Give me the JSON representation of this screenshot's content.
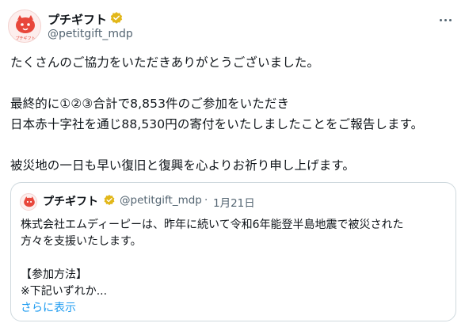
{
  "author": {
    "name": "プチギフト",
    "handle": "@petitgift_mdp",
    "logo_text": "プチギフト",
    "verified_color": "#e2b719"
  },
  "post": {
    "lines": [
      "たくさんのご協力をいただきありがとうございました。",
      "最終的に①②③合計で8,853件のご参加をいただき",
      "日本赤十字社を通じ88,530円の寄付をいたしましたことをご報告します。",
      "被災地の一日も早い復旧と復興を心よりお祈り申し上げます。"
    ]
  },
  "quote": {
    "author_name": "プチギフト",
    "author_handle": "@petitgift_mdp",
    "separator": "·",
    "date": "1月21日",
    "lines": [
      "株式会社エムディーピーは、昨年に続いて令和6年能登半島地震で被災された",
      "方々を支援いたします。",
      "【参加方法】",
      "※下記いずれか..."
    ],
    "show_more": "さらに表示"
  },
  "colors": {
    "text": "#0f1419",
    "secondary": "#536471",
    "link": "#1d9bf0",
    "border": "#cfd9de",
    "brand": "#e8473b"
  }
}
